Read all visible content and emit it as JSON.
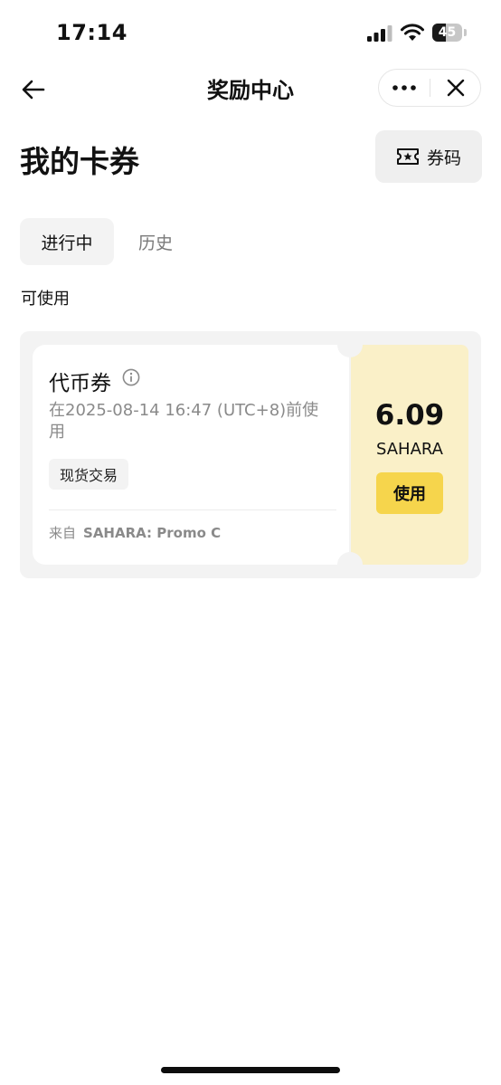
{
  "status_bar": {
    "time": "17:14",
    "battery_level": "45",
    "battery_fraction": 0.45
  },
  "nav": {
    "title": "奖励中心",
    "back_icon": "arrow-left-icon",
    "more_icon": "more-dots-icon",
    "close_icon": "close-icon"
  },
  "header": {
    "title": "我的卡券",
    "code_button_label": "券码",
    "code_button_icon": "ticket-star-icon"
  },
  "tabs": [
    {
      "label": "进行中",
      "active": true
    },
    {
      "label": "历史",
      "active": false
    }
  ],
  "section": {
    "label": "可使用"
  },
  "coupons": [
    {
      "title": "代币券",
      "expiry": "在2025-08-14 16:47 (UTC+8)前使用",
      "tag": "现货交易",
      "source_prefix": "来自",
      "source_name": "SAHARA: Promo C",
      "amount": "6.09",
      "currency": "SAHARA",
      "action_label": "使用"
    }
  ],
  "colors": {
    "accent_yellow": "#f6d54c",
    "coupon_right_bg": "#faf0c8",
    "card_bg": "#f3f3f3",
    "muted_text": "#8a8a8a"
  }
}
